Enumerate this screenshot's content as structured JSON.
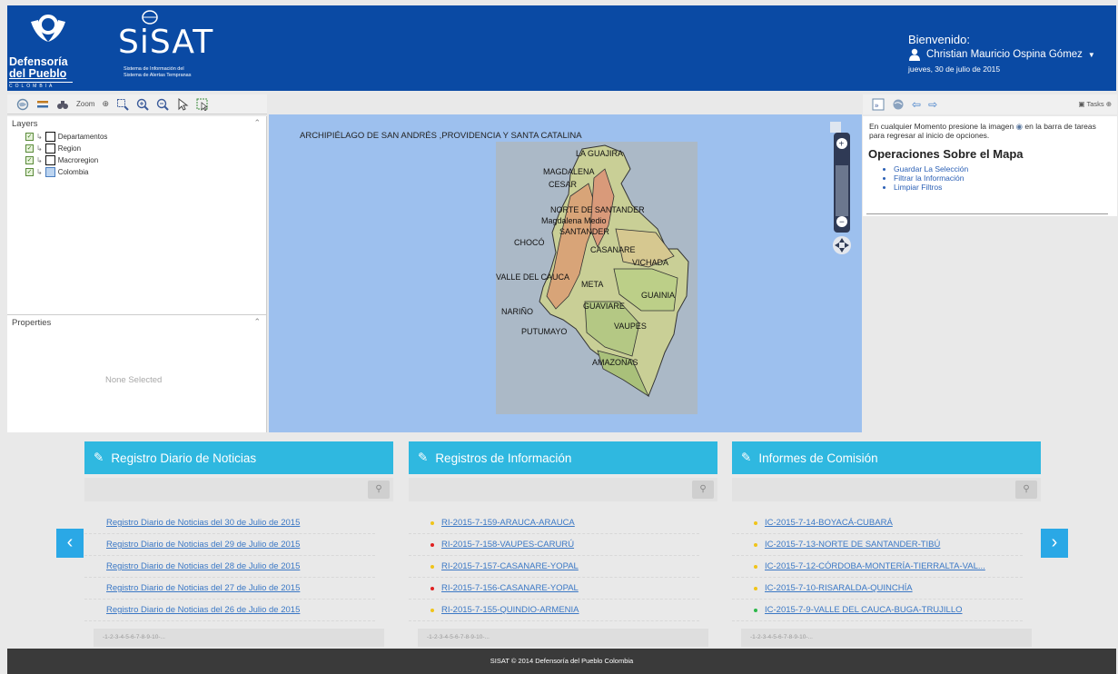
{
  "header": {
    "logo_lines": [
      "Defensoría",
      "del Pueblo"
    ],
    "logo_country": "COLOMBIA",
    "sisat_title": "SiSAT",
    "sisat_subtitle_1": "Sistema de Información del",
    "sisat_subtitle_2": "Sistema de Alertas Tempranas",
    "welcome": "Bienvenido:",
    "user_name": "Christian Mauricio Ospina Gómez",
    "date": "jueves, 30 de julio de 2015",
    "color": "#0a4aa4"
  },
  "toolbar": {
    "zoom_label": "Zoom"
  },
  "layers": {
    "title": "Layers",
    "items": [
      {
        "label": "Departamentos"
      },
      {
        "label": "Region"
      },
      {
        "label": "Macroregion"
      },
      {
        "label": "Colombia"
      }
    ]
  },
  "properties": {
    "title": "Properties",
    "empty": "None Selected"
  },
  "map": {
    "title": "ARCHIPIÉLAGO DE SAN ANDRÉS ,PROVIDENCIA Y SANTA CATALINA",
    "labels": [
      "LA GUAJIRA",
      "MAGDALENA",
      "CESAR",
      "NORTE DE SANTANDER",
      "Magdalena Medio",
      "SANTANDER",
      "CHOCÓ",
      "CASANARE",
      "VICHADA",
      "VALLE DEL CAUCA",
      "META",
      "GUAINIA",
      "NARIÑO",
      "GUAVIARE",
      "PUTUMAYO",
      "VAUPES",
      "AMAZONAS"
    ]
  },
  "right_panel": {
    "tasks_label": "Tasks",
    "intro_1": "En cualquier Momento presione la imagen",
    "intro_2": "en la barra de tareas para regresar al inicio de opciones.",
    "ops_title": "Operaciones Sobre el Mapa",
    "ops": [
      "Guardar La Selección",
      "Filtrar la Información",
      "Limpiar Filtros"
    ]
  },
  "cards": [
    {
      "title": "Registro Diario de Noticias",
      "items": [
        {
          "text": "Registro Diario de Noticias del 30 de Julio de 2015",
          "dot": ""
        },
        {
          "text": "Registro Diario de Noticias del 29 de Julio de 2015",
          "dot": ""
        },
        {
          "text": "Registro Diario de Noticias del 28 de Julio de 2015",
          "dot": ""
        },
        {
          "text": "Registro Diario de Noticias del 27 de Julio de 2015",
          "dot": ""
        },
        {
          "text": "Registro Diario de Noticias del 26 de Julio de 2015",
          "dot": ""
        }
      ],
      "pager": "-1-2-3-4-5-6-7-8-9-10-..."
    },
    {
      "title": "Registros de Información",
      "items": [
        {
          "text": "RI-2015-7-159-ARAUCA-ARAUCA",
          "dot": "#f0c419"
        },
        {
          "text": "RI-2015-7-158-VAUPES-CARURÚ",
          "dot": "#e02020"
        },
        {
          "text": "RI-2015-7-157-CASANARE-YOPAL",
          "dot": "#f0c419"
        },
        {
          "text": "RI-2015-7-156-CASANARE-YOPAL",
          "dot": "#e02020"
        },
        {
          "text": "RI-2015-7-155-QUINDIO-ARMENIA",
          "dot": "#f0c419"
        }
      ],
      "pager": "-1-2-3-4-5-6-7-8-9-10-..."
    },
    {
      "title": "Informes de Comisión",
      "items": [
        {
          "text": "IC-2015-7-14-BOYACÁ-CUBARÁ",
          "dot": "#f0c419"
        },
        {
          "text": "IC-2015-7-13-NORTE DE SANTANDER-TIBÚ",
          "dot": "#f0c419"
        },
        {
          "text": "IC-2015-7-12-CÓRDOBA-MONTERÍA-TIERRALTA-VAL...",
          "dot": "#f0c419"
        },
        {
          "text": "IC-2015-7-10-RISARALDA-QUINCHÍA",
          "dot": "#f0c419"
        },
        {
          "text": "IC-2015-7-9-VALLE DEL CAUCA-BUGA-TRUJILLO",
          "dot": "#2db84a"
        }
      ],
      "pager": "-1-2-3-4-5-6-7-8-9-10-..."
    }
  ],
  "footer": "SISAT © 2014 Defensoría del Pueblo Colombia"
}
